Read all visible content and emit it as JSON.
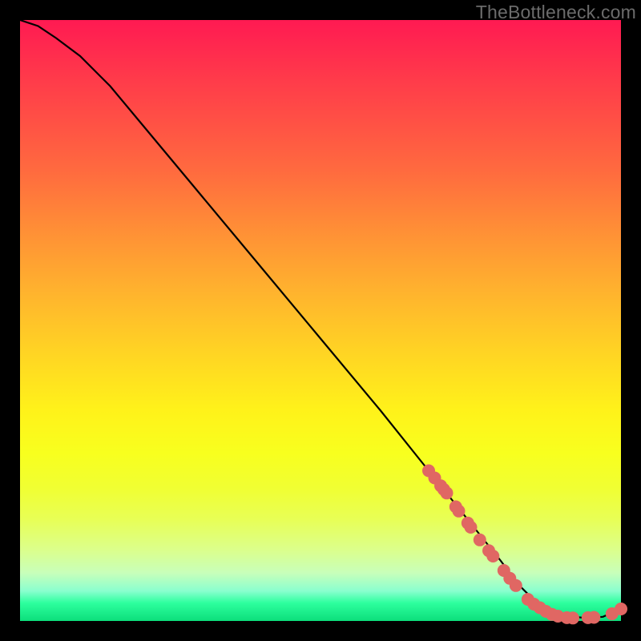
{
  "attribution": "TheBottleneck.com",
  "chart_data": {
    "type": "line",
    "title": "",
    "xlabel": "",
    "ylabel": "",
    "xlim": [
      0,
      100
    ],
    "ylim": [
      0,
      100
    ],
    "grid": false,
    "legend": false,
    "series": [
      {
        "name": "bottleneck-curve",
        "x": [
          0,
          3,
          6,
          10,
          15,
          20,
          30,
          40,
          50,
          60,
          68,
          72,
          76,
          80,
          83,
          86,
          90,
          94,
          97,
          100
        ],
        "y": [
          100,
          99,
          97,
          94,
          89,
          83,
          71,
          59,
          47,
          35,
          25,
          20,
          15,
          10,
          6,
          3,
          1,
          0.5,
          0.7,
          2
        ]
      }
    ],
    "markers": [
      {
        "x": 68.0,
        "y": 25.0
      },
      {
        "x": 69.0,
        "y": 23.8
      },
      {
        "x": 70.0,
        "y": 22.5
      },
      {
        "x": 70.5,
        "y": 21.9
      },
      {
        "x": 71.0,
        "y": 21.3
      },
      {
        "x": 72.5,
        "y": 19.0
      },
      {
        "x": 73.0,
        "y": 18.3
      },
      {
        "x": 74.5,
        "y": 16.3
      },
      {
        "x": 75.0,
        "y": 15.6
      },
      {
        "x": 76.5,
        "y": 13.5
      },
      {
        "x": 78.0,
        "y": 11.7
      },
      {
        "x": 78.7,
        "y": 10.8
      },
      {
        "x": 80.5,
        "y": 8.4
      },
      {
        "x": 81.5,
        "y": 7.1
      },
      {
        "x": 82.5,
        "y": 5.9
      },
      {
        "x": 84.5,
        "y": 3.6
      },
      {
        "x": 85.5,
        "y": 2.8
      },
      {
        "x": 86.5,
        "y": 2.2
      },
      {
        "x": 87.5,
        "y": 1.6
      },
      {
        "x": 88.5,
        "y": 1.1
      },
      {
        "x": 89.5,
        "y": 0.8
      },
      {
        "x": 91.0,
        "y": 0.55
      },
      {
        "x": 92.0,
        "y": 0.5
      },
      {
        "x": 94.5,
        "y": 0.55
      },
      {
        "x": 95.5,
        "y": 0.6
      },
      {
        "x": 98.5,
        "y": 1.2
      },
      {
        "x": 100.0,
        "y": 2.0
      }
    ]
  },
  "colors": {
    "marker": "#e06763",
    "line": "#000000"
  }
}
